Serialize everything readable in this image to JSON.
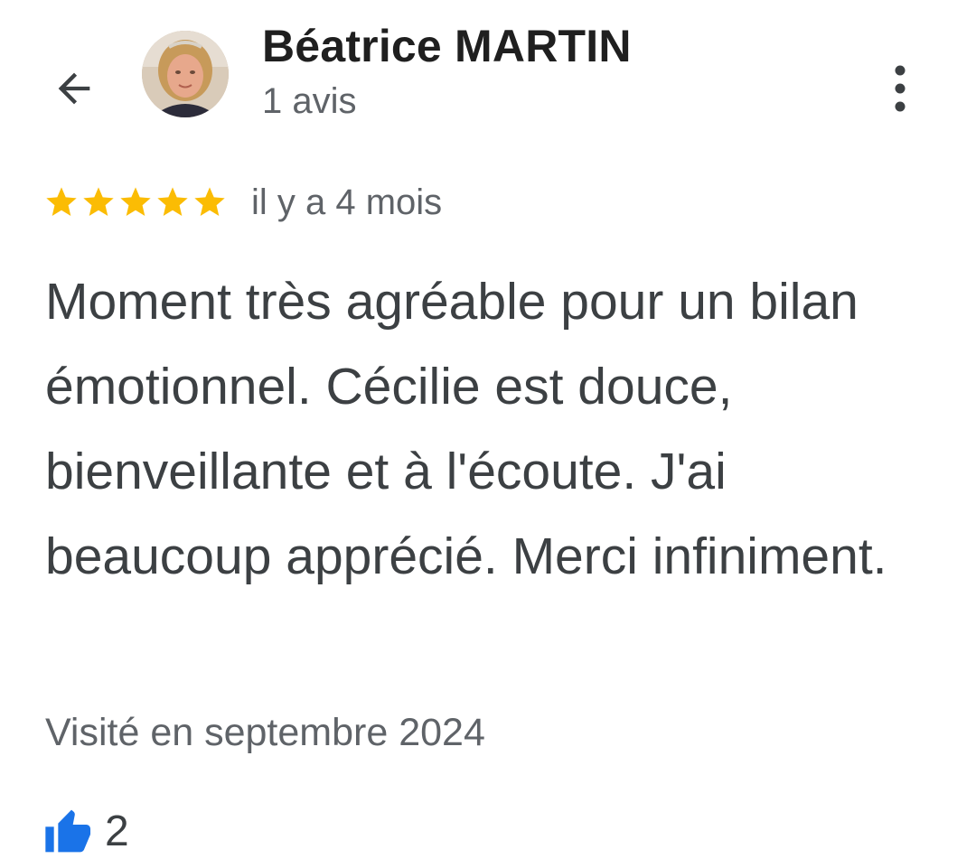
{
  "reviewer": {
    "name": "Béatrice MARTIN",
    "review_count": "1 avis"
  },
  "review": {
    "rating": 5,
    "max_rating": 5,
    "date": "il y a 4 mois",
    "text": "Moment très agréable pour un bilan émotionnel. Cécilie est douce, bienveillante et à l'écoute. J'ai beaucoup apprécié. Merci infiniment.",
    "visited": "Visité en septembre 2024",
    "likes": "2"
  },
  "icons": {
    "back": "arrow-back-icon",
    "more": "more-vert-icon",
    "star": "star-icon",
    "like": "thumbs-up-icon"
  },
  "colors": {
    "star": "#fbbc04",
    "like": "#1a73e8",
    "primary_text": "#1f1f1f",
    "secondary_text": "#5f6368",
    "body_text": "#3c4043"
  }
}
